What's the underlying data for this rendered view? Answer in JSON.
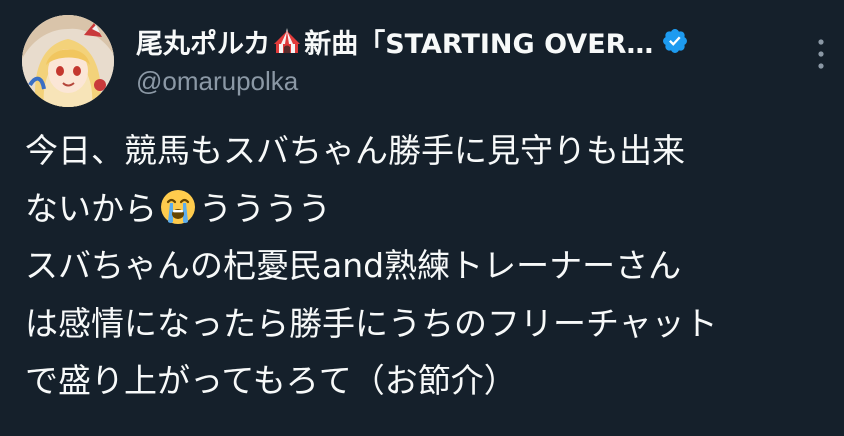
{
  "tweet": {
    "author": {
      "display_name_part1": "尾丸ポルカ",
      "name_icon": "circus-tent-icon",
      "display_name_part2": "新曲「STARTING OVER…",
      "verified_icon": "verified-badge-icon",
      "handle": "@omarupolka"
    },
    "menu_icon": "more-vertical-icon",
    "body": {
      "line1": "今日、競馬もスバちゃん勝手に見守りも出来",
      "line2_text": "ないから",
      "line2_emoji": "loudly-crying-face-emoji",
      "line2_after": "うううう",
      "line3": "スバちゃんの杞憂民and熟練トレーナーさん",
      "line4": "は感情になったら勝手にうちのフリーチャット",
      "line5": "で盛り上がってもろて（お節介）"
    },
    "colors": {
      "background": "#15202b",
      "text": "#f7f9f9",
      "secondary_text": "#8b98a5",
      "verified": "#1d9bf0"
    }
  }
}
